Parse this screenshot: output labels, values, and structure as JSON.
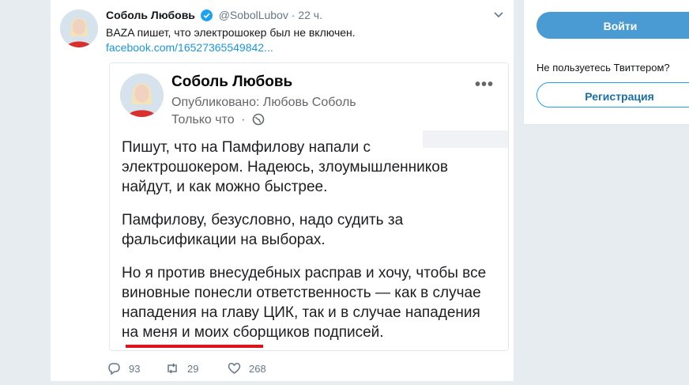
{
  "tweet": {
    "author_name": "Соболь Любовь",
    "handle": "@SobolLubov",
    "separator": "·",
    "time": "22 ч.",
    "text": "BAZA пишет, что электрошокер был не включен.",
    "link": "facebook.com/16527365549842..."
  },
  "embed": {
    "author_name": "Соболь Любовь",
    "published_by": "Опубликовано: Любовь Соболь",
    "time": "Только что",
    "meta_separator": "·",
    "more_label": "•••",
    "paragraphs": [
      "Пишут, что на Памфилову напали с электрошокером. Надеюсь, злоумышленников найдут, и как можно быстрее.",
      "Памфилову, безусловно, надо судить за фальсификации на выборах.",
      "Но я против внесудебных расправ и хочу, чтобы все виновные понесли ответственность — как в случае нападения на главу ЦИК, так и в случае нападения на меня и моих сборщиков подписей."
    ]
  },
  "actions": {
    "replies": "93",
    "retweets": "29",
    "likes": "268"
  },
  "sidebar": {
    "login_label": "Войти",
    "note": "Не пользуетесь Твиттером?",
    "signup_label": "Регистрация"
  },
  "colors": {
    "link": "#1b95e0",
    "primary_button": "#4a9bd4",
    "underline": "#e0121a"
  }
}
